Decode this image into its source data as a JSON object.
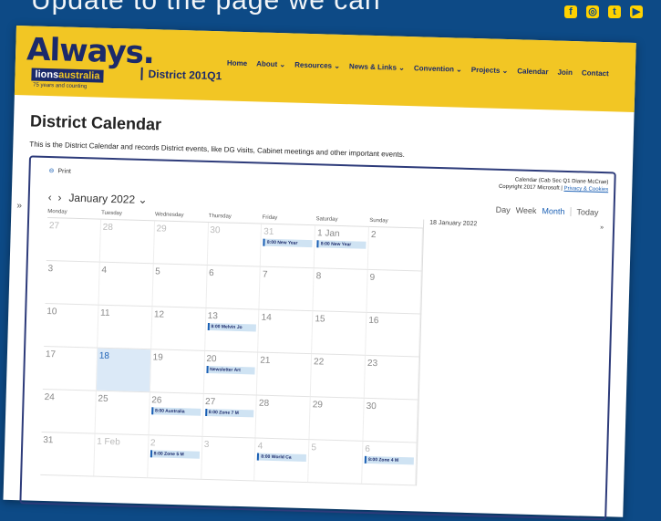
{
  "backdrop": {
    "text": "Update to the page we can"
  },
  "social": [
    {
      "icon": "facebook-icon",
      "glyph": "f"
    },
    {
      "icon": "instagram-icon",
      "glyph": "◎"
    },
    {
      "icon": "twitter-icon",
      "glyph": "t"
    },
    {
      "icon": "youtube-icon",
      "glyph": "▶"
    }
  ],
  "header": {
    "logo": "Always.",
    "lions_label_1": "lions",
    "lions_label_2": "australia",
    "lions_sub": "75 years and counting",
    "district": "District 201Q1",
    "nav": [
      "Home",
      "About ⌄",
      "Resources ⌄",
      "News & Links ⌄",
      "Convention ⌄",
      "Projects ⌄",
      "Calendar",
      "Join",
      "Contact"
    ]
  },
  "page": {
    "title": "District Calendar",
    "description": "This is the District Calendar and records District events, like DG visits, Cabinet meetings and other important events."
  },
  "calendar": {
    "source": "Calendar (Cab Sec Q1 Diane McCrae)",
    "copyright": "Copyright 2017 Microsoft | ",
    "privacy_link": "Privacy & Cookies",
    "print": "Print",
    "expander": "»",
    "prev": "‹",
    "next": "›",
    "month": "January 2022 ⌄",
    "views": [
      "Day",
      "Week",
      "Month"
    ],
    "active_view": "Month",
    "today": "Today",
    "weekdays": [
      "Monday",
      "Tuesday",
      "Wednesday",
      "Thursday",
      "Friday",
      "Saturday",
      "Sunday"
    ],
    "weeks": [
      [
        {
          "n": "27",
          "dim": true
        },
        {
          "n": "28",
          "dim": true
        },
        {
          "n": "29",
          "dim": true
        },
        {
          "n": "30",
          "dim": true
        },
        {
          "n": "31",
          "dim": true,
          "ev": "8:00 New Year"
        },
        {
          "n": "1 Jan",
          "ev": "8:00 New Year"
        },
        {
          "n": "2"
        }
      ],
      [
        {
          "n": "3"
        },
        {
          "n": "4"
        },
        {
          "n": "5"
        },
        {
          "n": "6"
        },
        {
          "n": "7"
        },
        {
          "n": "8"
        },
        {
          "n": "9"
        }
      ],
      [
        {
          "n": "10"
        },
        {
          "n": "11"
        },
        {
          "n": "12"
        },
        {
          "n": "13",
          "ev": "8:00 Melvin Jo"
        },
        {
          "n": "14"
        },
        {
          "n": "15"
        },
        {
          "n": "16"
        }
      ],
      [
        {
          "n": "17"
        },
        {
          "n": "18",
          "selected": true
        },
        {
          "n": "19"
        },
        {
          "n": "20",
          "ev": "Newsletter Art"
        },
        {
          "n": "21"
        },
        {
          "n": "22"
        },
        {
          "n": "23"
        }
      ],
      [
        {
          "n": "24"
        },
        {
          "n": "25"
        },
        {
          "n": "26",
          "ev": "8:00 Australia"
        },
        {
          "n": "27",
          "ev": "8:00 Zone 7 M"
        },
        {
          "n": "28"
        },
        {
          "n": "29"
        },
        {
          "n": "30"
        }
      ],
      [
        {
          "n": "31"
        },
        {
          "n": "1 Feb",
          "dim": true
        },
        {
          "n": "2",
          "dim": true,
          "ev": "8:00 Zone 5 M"
        },
        {
          "n": "3",
          "dim": true
        },
        {
          "n": "4",
          "dim": true,
          "ev": "8:00 World Ca"
        },
        {
          "n": "5",
          "dim": true
        },
        {
          "n": "6",
          "dim": true,
          "ev": "8:00 Zone 4 M"
        }
      ]
    ],
    "agenda_date": "18 January 2022",
    "agenda_chevron": "»"
  }
}
